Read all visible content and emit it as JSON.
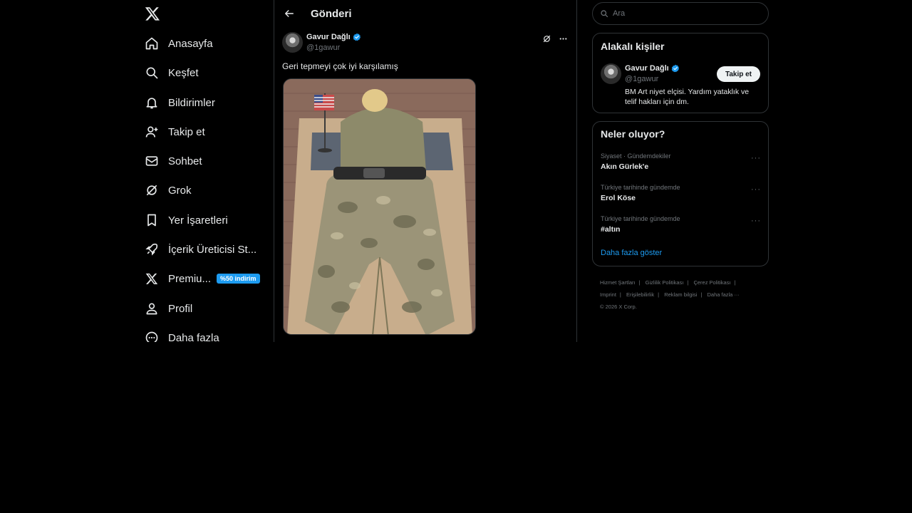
{
  "nav": {
    "items": [
      {
        "label": "Anasayfa",
        "icon": "home-icon"
      },
      {
        "label": "Keşfet",
        "icon": "search-icon"
      },
      {
        "label": "Bildirimler",
        "icon": "bell-icon"
      },
      {
        "label": "Takip et",
        "icon": "person-plus-icon"
      },
      {
        "label": "Sohbet",
        "icon": "envelope-icon"
      },
      {
        "label": "Grok",
        "icon": "grok-icon"
      },
      {
        "label": "Yer İşaretleri",
        "icon": "bookmark-icon"
      },
      {
        "label": "İçerik Üreticisi St...",
        "icon": "rocket-icon"
      },
      {
        "label": "Premiu...",
        "icon": "x-logo-icon"
      },
      {
        "label": "Profil",
        "icon": "person-icon"
      },
      {
        "label": "Daha fazla",
        "icon": "more-circle-icon"
      }
    ],
    "premium_badge": "%50 indirim"
  },
  "main": {
    "title": "Gönderi",
    "post": {
      "author_name": "Gavur Dağlı",
      "author_handle": "@1gawur",
      "text": "Geri tepmeyi çok iyi karşılamış"
    }
  },
  "search": {
    "placeholder": "Ara"
  },
  "related": {
    "title": "Alakalı kişiler",
    "person": {
      "name": "Gavur Dağlı",
      "handle": "@1gawur",
      "bio": "BM Art niyet elçisi. Yardım yataklık ve telif hakları için dm.",
      "follow_label": "Takip et"
    }
  },
  "trends": {
    "title": "Neler oluyor?",
    "items": [
      {
        "category": "Siyaset · Gündemdekiler",
        "name": "Akın Gürlek'e"
      },
      {
        "category": "Türkiye tarihinde gündemde",
        "name": "Erol Köse"
      },
      {
        "category": "Türkiye tarihinde gündemde",
        "name": "#altın"
      }
    ],
    "show_more": "Daha fazla göster"
  },
  "footer": {
    "links": [
      "Hizmet Şartları",
      "Gizlilik Politikası",
      "Çerez Politikası",
      "Imprint",
      "Erişilebilirlik",
      "Reklam bilgisi",
      "Daha fazla ···"
    ],
    "copyright": "© 2026 X Corp."
  },
  "colors": {
    "background": "#000000",
    "text": "#e7e9ea",
    "muted": "#71767b",
    "accent": "#1d9bf0",
    "border": "#2f3336"
  }
}
